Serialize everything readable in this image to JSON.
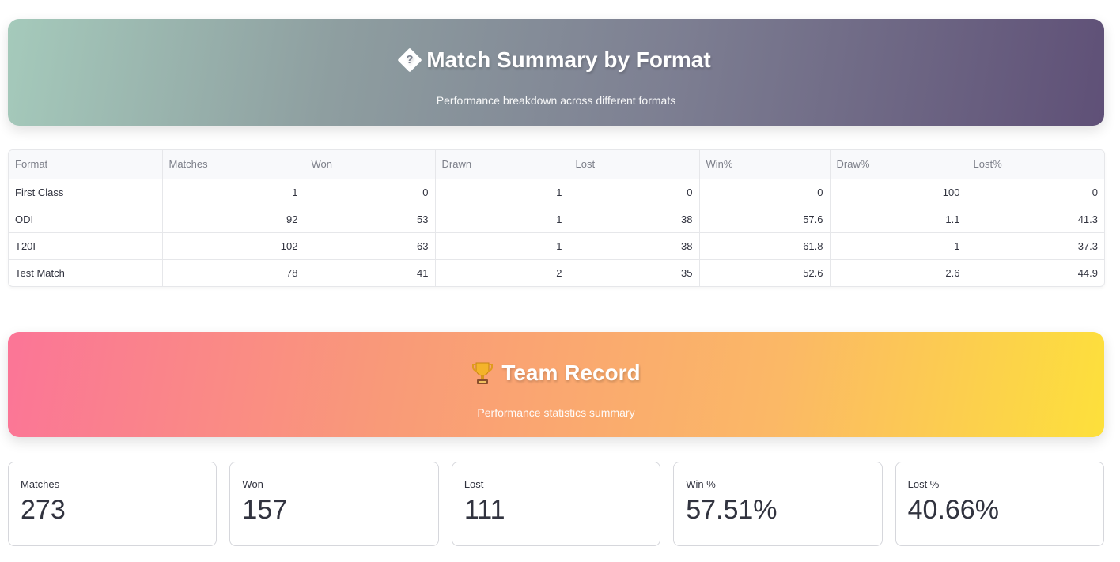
{
  "summary_banner": {
    "icon": "diamond-question-icon",
    "icon_glyph": "?",
    "title": "Match Summary by Format",
    "subtitle": "Performance breakdown across different formats",
    "gradient_colors": [
      "#a5cabb",
      "#5f5077"
    ]
  },
  "format_table": {
    "columns": [
      "Format",
      "Matches",
      "Won",
      "Drawn",
      "Lost",
      "Win%",
      "Draw%",
      "Lost%"
    ],
    "rows": [
      [
        "First Class",
        "1",
        "0",
        "1",
        "0",
        "0",
        "100",
        "0"
      ],
      [
        "ODI",
        "92",
        "53",
        "1",
        "38",
        "57.6",
        "1.1",
        "41.3"
      ],
      [
        "T20I",
        "102",
        "63",
        "1",
        "38",
        "61.8",
        "1",
        "37.3"
      ],
      [
        "Test Match",
        "78",
        "41",
        "2",
        "35",
        "52.6",
        "2.6",
        "44.9"
      ]
    ]
  },
  "record_banner": {
    "icon": "trophy-icon",
    "title": "Team Record",
    "subtitle": "Performance statistics summary",
    "gradient_colors": [
      "#fb7597",
      "#fde03b"
    ]
  },
  "metrics": [
    {
      "label": "Matches",
      "value": "273"
    },
    {
      "label": "Won",
      "value": "157"
    },
    {
      "label": "Lost",
      "value": "111"
    },
    {
      "label": "Win %",
      "value": "57.51%"
    },
    {
      "label": "Lost %",
      "value": "40.66%"
    }
  ]
}
